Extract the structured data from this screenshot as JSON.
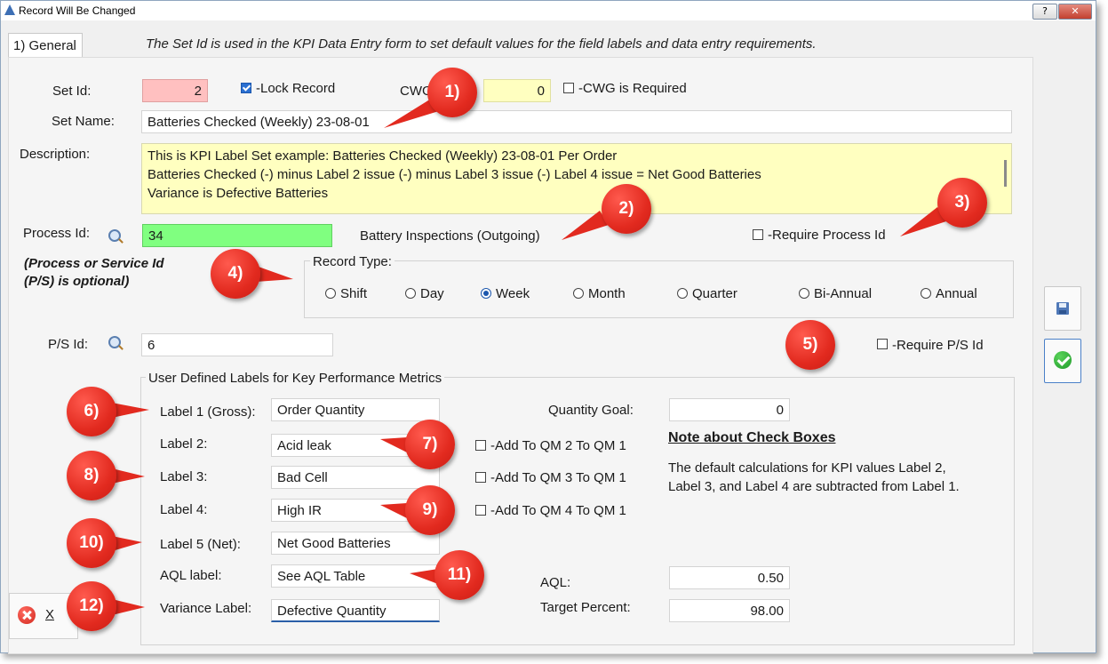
{
  "window": {
    "title": "Record Will Be Changed",
    "help_label": "?",
    "close_label": "✕"
  },
  "tab": {
    "label": "1) General",
    "description": "The Set Id is used in the KPI Data Entry form to set default values for the field labels and data entry requirements."
  },
  "form": {
    "set_id_label": "Set Id:",
    "set_id_value": "2",
    "lock_record_label": "-Lock Record",
    "lock_record_checked": true,
    "cwg_label": "CWG:",
    "cwg_value": "0",
    "cwg_required_label": "-CWG is Required",
    "set_name_label": "Set Name:",
    "set_name_value": "Batteries Checked (Weekly) 23-08-01",
    "description_label": "Description:",
    "description_lines": [
      "This is KPI Label Set example: Batteries Checked (Weekly) 23-08-01 Per Order",
      "Batteries Checked (-) minus Label 2 issue (-) minus Label 3 issue (-) Label 4 issue = Net Good Batteries",
      "Variance is Defective Batteries"
    ],
    "process_id_label": "Process Id:",
    "process_id_value": "34",
    "process_name": "Battery Inspections (Outgoing)",
    "require_process_label": "-Require Process Id",
    "ps_optional_note_1": "(Process or Service Id",
    "ps_optional_note_2": "(P/S) is optional)",
    "record_type_label": "Record Type:",
    "record_types": [
      "Shift",
      "Day",
      "Week",
      "Month",
      "Quarter",
      "Bi-Annual",
      "Annual"
    ],
    "record_type_selected": "Week",
    "ps_id_label": "P/S Id:",
    "ps_id_value": "6",
    "require_ps_label": "-Require P/S Id"
  },
  "metrics": {
    "group_title": "User Defined Labels for Key Performance Metrics",
    "label1_caption": "Label 1 (Gross):",
    "label1_value": "Order Quantity",
    "label2_caption": "Label 2:",
    "label2_value": "Acid leak",
    "label3_caption": "Label 3:",
    "label3_value": "Bad Cell",
    "label4_caption": "Label 4:",
    "label4_value": "High IR",
    "label5_caption": "Label 5 (Net):",
    "label5_value": "Net Good Batteries",
    "aql_caption": "AQL label:",
    "aql_value": "See AQL Table",
    "variance_caption": "Variance Label:",
    "variance_value": "Defective Quantity",
    "qm2_label": "-Add To QM 2 To QM 1",
    "qm3_label": "-Add To QM 3 To QM 1",
    "qm4_label": "-Add To QM 4 To QM 1",
    "quantity_goal_label": "Quantity Goal:",
    "quantity_goal_value": "0",
    "note_title": "Note about Check Boxes",
    "note_line1": "The default calculations for KPI values Label 2,",
    "note_line2": "Label 3, and Label 4 are subtracted from Label 1.",
    "aql_label": "AQL:",
    "aql_number": "0.50",
    "target_label": "Target Percent:",
    "target_value": "98.00"
  },
  "buttons": {
    "cancel_label": "X"
  },
  "callouts": [
    "1)",
    "2)",
    "3)",
    "4)",
    "5)",
    "6)",
    "7)",
    "8)",
    "9)",
    "10)",
    "11)",
    "12)"
  ],
  "colors": {
    "set_id_bg": "#ffc0c0",
    "cwg_bg": "#ffffc0",
    "description_bg": "#ffffc0",
    "process_bg": "#80ff80",
    "callout": "#e22a1f"
  }
}
